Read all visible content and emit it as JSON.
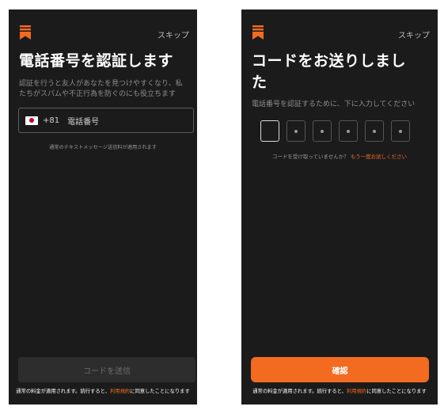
{
  "left": {
    "skip": "スキップ",
    "title": "電話番号を認証します",
    "description": "認証を行うと友人があなたを見つけやすくなり、私たちがスパムや不正行為を防ぐのにも役立ちます",
    "country_code": "+81",
    "phone_placeholder": "電話番号",
    "sms_note": "通常のテキストメッセージ送信料が適用されます",
    "send_button": "コードを送信",
    "footer_prefix": "通常の料金が適用されます。続行すると、",
    "footer_link": "利用規約",
    "footer_suffix": "に同意したことになります"
  },
  "right": {
    "skip": "スキップ",
    "title_line1": "コードをお送りしまし",
    "title_line2": "た",
    "description": "電話番号を認証するために、下に入力してください",
    "resend_question": "コードを受け取っていませんか？",
    "resend_link": "もう一度お試しください",
    "confirm_button": "確認",
    "footer_prefix": "通常の料金が適用されます。続行すると、",
    "footer_link": "利用規約",
    "footer_suffix": "に同意したことになります"
  },
  "colors": {
    "background": "#1b1b1c",
    "accent": "#f26b21"
  },
  "icons": {
    "logo": "bookmark-logo-icon",
    "flag": "japan-flag-icon"
  }
}
